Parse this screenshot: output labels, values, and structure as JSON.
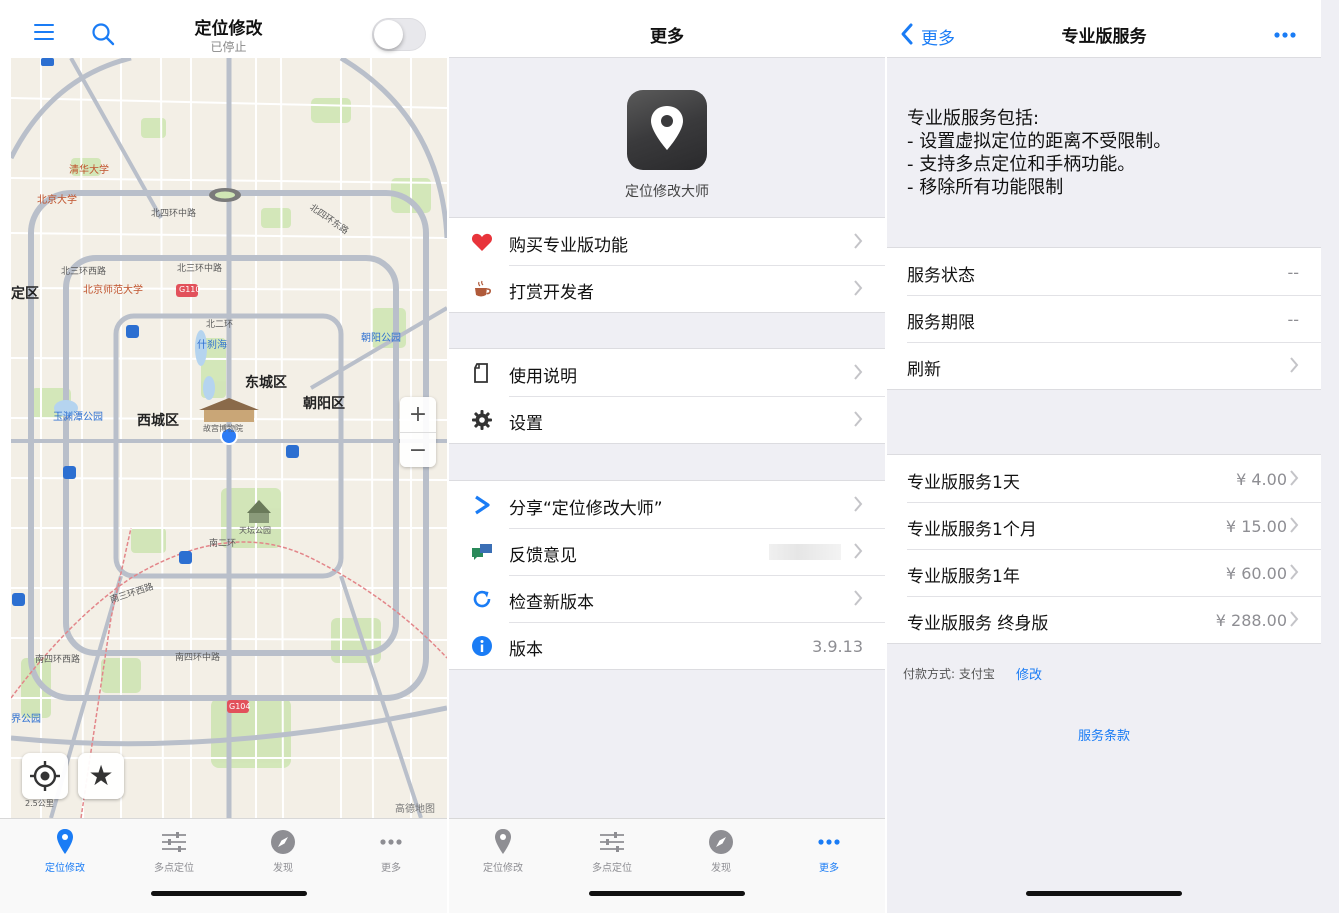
{
  "panel1": {
    "title": "定位修改",
    "subtitle": "已停止",
    "map_labels": {
      "tsinghua": "清华大学",
      "pku": "北京大学",
      "bnu": "北京师范大学",
      "shichahai": "什刹海",
      "yuyuantan": "玉渊潭公园",
      "chaoyang_park": "朝阳公园",
      "tiantan": "天坛公园",
      "palace": "故宫博物院",
      "dongcheng": "东城区",
      "xicheng": "西城区",
      "chaoyang": "朝阳区",
      "edge_district": "定区",
      "edge_park": "界公园",
      "north4": "北四环中路",
      "north4e": "北四环东路",
      "north3w": "北三环西路",
      "north3m": "北三环中路",
      "north2": "北二环",
      "south2": "南二环",
      "south3w": "南三环西路",
      "south4w": "南四环西路",
      "south4m": "南四环中路",
      "road_g110": "G110",
      "road_g104": "G104",
      "attribution": "高德地图",
      "scale": "2.5公里"
    },
    "zoom_in": "+",
    "zoom_out": "−"
  },
  "tabs": [
    {
      "label": "定位修改",
      "icon": "location-pin-icon"
    },
    {
      "label": "多点定位",
      "icon": "sliders-icon"
    },
    {
      "label": "发现",
      "icon": "compass-icon"
    },
    {
      "label": "更多",
      "icon": "more-dots-icon"
    }
  ],
  "panel2": {
    "title": "更多",
    "app_name": "定位修改大师",
    "group1": [
      {
        "label": "购买专业版功能",
        "icon": "heart-icon"
      },
      {
        "label": "打赏开发者",
        "icon": "coffee-icon"
      }
    ],
    "group2": [
      {
        "label": "使用说明",
        "icon": "document-icon"
      },
      {
        "label": "设置",
        "icon": "gear-icon"
      }
    ],
    "group3": [
      {
        "label": "分享“定位修改大师”",
        "icon": "share-icon"
      },
      {
        "label": "反馈意见",
        "icon": "feedback-icon"
      },
      {
        "label": "检查新版本",
        "icon": "refresh-icon"
      },
      {
        "label": "版本",
        "icon": "info-icon",
        "value": "3.9.13"
      }
    ]
  },
  "panel3": {
    "back_label": "更多",
    "title": "专业版服务",
    "description": "专业版服务包括:\n- 设置虚拟定位的距离不受限制。\n- 支持多点定位和手柄功能。\n- 移除所有功能限制",
    "status_rows": [
      {
        "label": "服务状态",
        "value": "--"
      },
      {
        "label": "服务期限",
        "value": "--"
      },
      {
        "label": "刷新"
      }
    ],
    "plans": [
      {
        "label": "专业版服务1天",
        "price": "¥ 4.00"
      },
      {
        "label": "专业版服务1个月",
        "price": "¥ 15.00"
      },
      {
        "label": "专业版服务1年",
        "price": "¥ 60.00"
      },
      {
        "label": "专业版服务 终身版",
        "price": "¥ 288.00"
      }
    ],
    "payment_label": "付款方式: 支付宝",
    "payment_link": "修改",
    "terms": "服务条款"
  },
  "colors": {
    "accent": "#1a7cf5",
    "heart": "#e8343b",
    "share": "#1a7cf5",
    "feedback": "#2a8a5a"
  }
}
